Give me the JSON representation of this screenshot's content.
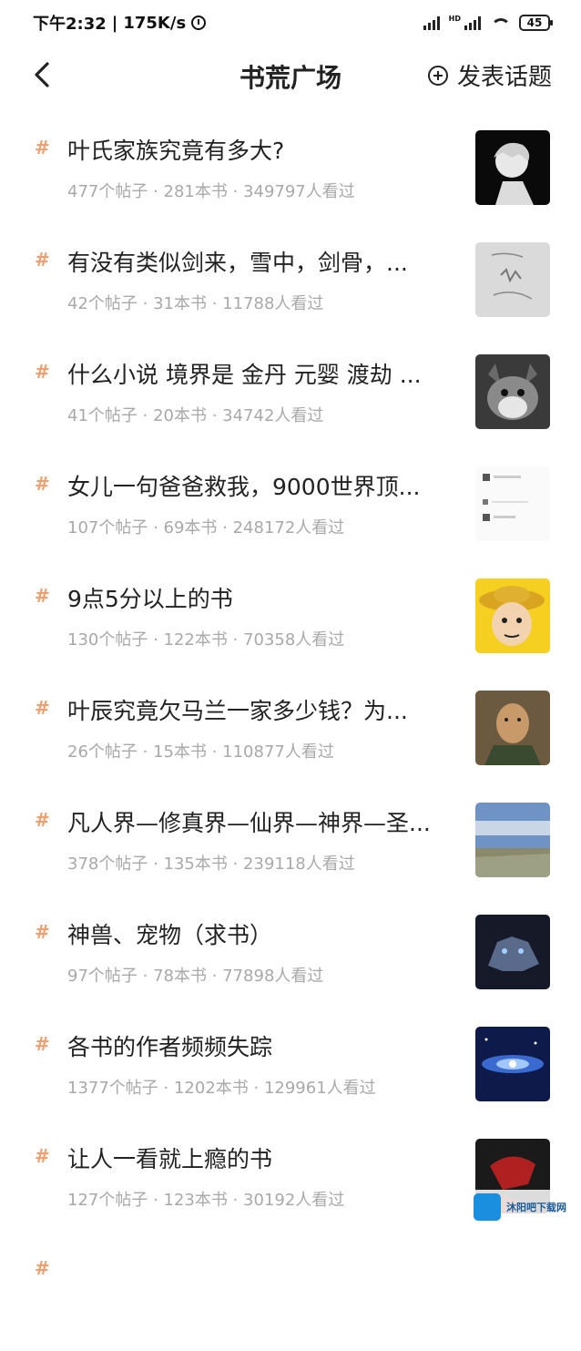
{
  "status_bar": {
    "time": "下午2:32",
    "speed": "175K/s",
    "battery": "45"
  },
  "header": {
    "title": "书荒广场",
    "post_label": "发表话题"
  },
  "topics": [
    {
      "title": "叶氏家族究竟有多大?",
      "meta": "477个帖子 · 281本书 · 349797人看过"
    },
    {
      "title": "有没有类似剑来，雪中，剑骨，...",
      "meta": "42个帖子 · 31本书 · 11788人看过"
    },
    {
      "title": "什么小说 境界是 金丹 元婴 渡劫 ...",
      "meta": "41个帖子 · 20本书 · 34742人看过"
    },
    {
      "title": "女儿一句爸爸救我，9000世界顶...",
      "meta": "107个帖子 · 69本书 · 248172人看过"
    },
    {
      "title": "9点5分以上的书",
      "meta": "130个帖子 · 122本书 · 70358人看过"
    },
    {
      "title": "叶辰究竟欠马兰一家多少钱？为...",
      "meta": "26个帖子 · 15本书 · 110877人看过"
    },
    {
      "title": "凡人界—修真界—仙界—神界—圣...",
      "meta": "378个帖子 · 135本书 · 239118人看过"
    },
    {
      "title": "神兽、宠物（求书）",
      "meta": "97个帖子 · 78本书 · 77898人看过"
    },
    {
      "title": "各书的作者频频失踪",
      "meta": "1377个帖子 · 1202本书 · 129961人看过"
    },
    {
      "title": "让人一看就上瘾的书",
      "meta": "127个帖子 · 123本书 · 30192人看过"
    },
    {
      "title": "",
      "meta": ""
    }
  ],
  "watermark": {
    "text": "沐阳吧下载网"
  }
}
